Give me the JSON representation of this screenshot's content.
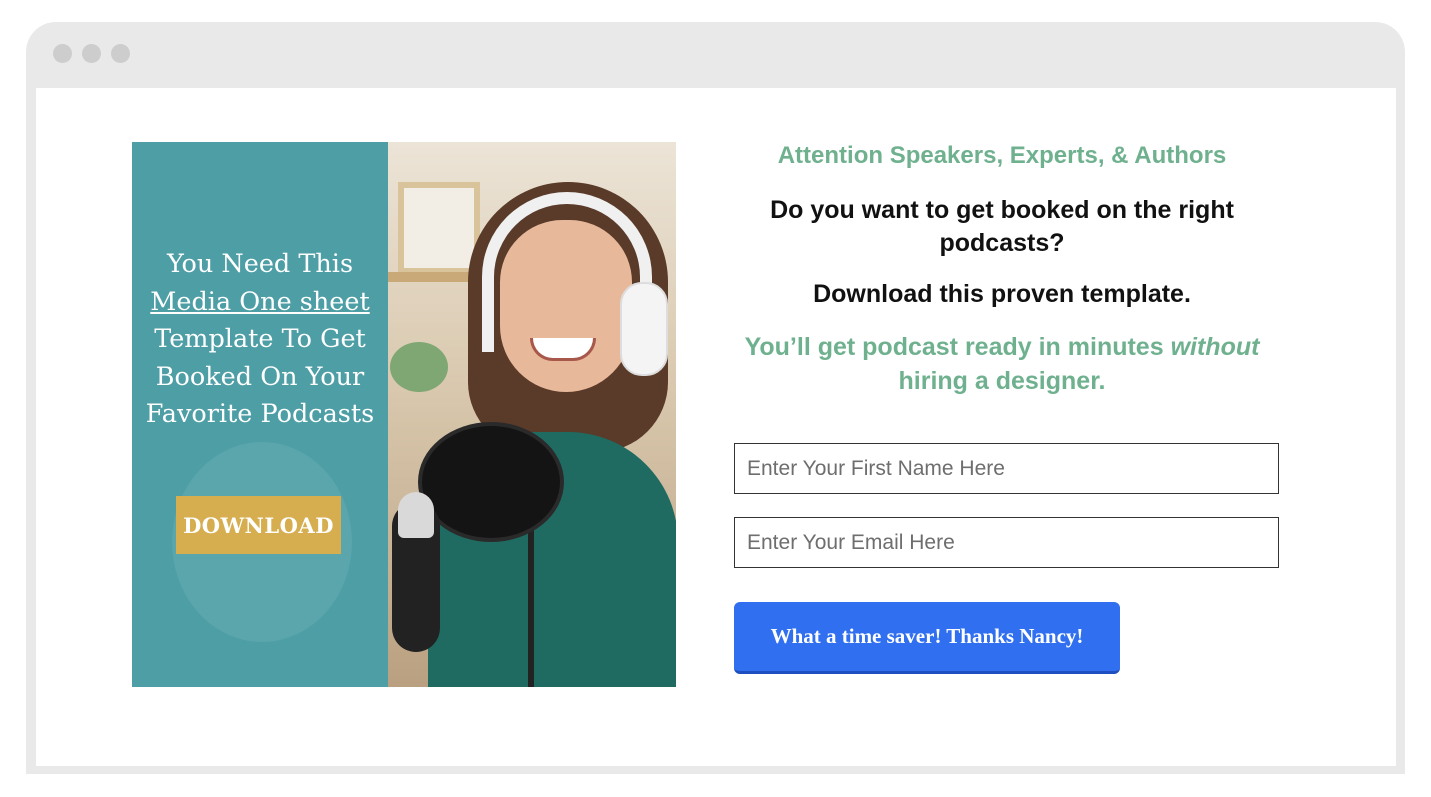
{
  "window": {
    "dots": [
      "dot-1",
      "dot-2",
      "dot-3"
    ]
  },
  "promo": {
    "headline_line1": "You Need This",
    "headline_link": "Media One sheet",
    "headline_line3": "Template To Get",
    "headline_line4": "Booked On Your",
    "headline_line5": "Favorite Podcasts",
    "download_label": "DOWNLOAD"
  },
  "form": {
    "tagline": "Attention Speakers, Experts, & Authors",
    "question": "Do you want to get booked on the right podcasts?",
    "download_line": "Download this proven template.",
    "benefit_part1": "You’ll get podcast ready in minutes",
    "benefit_emphasis": "without",
    "benefit_part2": "hiring a designer.",
    "first_name_placeholder": "Enter Your First Name Here",
    "email_placeholder": "Enter Your Email Here",
    "submit_label": "What a time saver! Thanks Nancy!"
  },
  "colors": {
    "accent_green": "#6fb18f",
    "panel_teal": "#4e9ea6",
    "download_gold": "#d6ae4f",
    "submit_blue": "#2f6ff0"
  }
}
